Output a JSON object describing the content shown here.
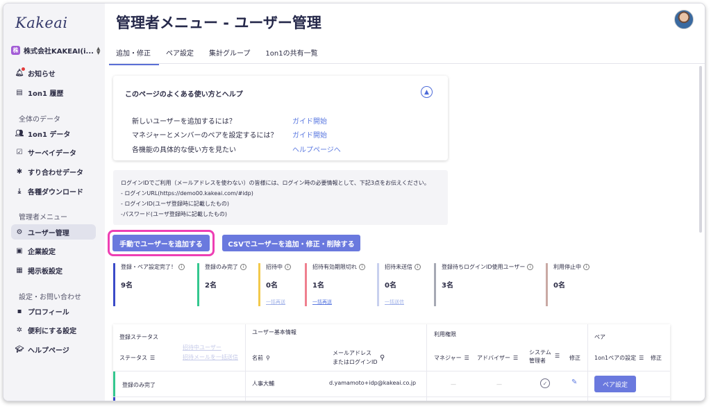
{
  "app": {
    "logo": "Kakeai"
  },
  "sidebar": {
    "company": {
      "badge": "株",
      "name": "株式会社KAKEAI(i..."
    },
    "items": [
      {
        "label": "お知らせ",
        "icon": "bell-icon"
      },
      {
        "label": "1on1 履歴",
        "icon": "history-icon"
      },
      {
        "label": "1on1 データ",
        "icon": "people-icon"
      },
      {
        "label": "サーベイデータ",
        "icon": "survey-icon"
      },
      {
        "label": "すり合わせデータ",
        "icon": "puzzle-icon"
      },
      {
        "label": "各種ダウンロード",
        "icon": "download-icon"
      },
      {
        "label": "ユーザー管理",
        "icon": "users-gear-icon"
      },
      {
        "label": "企業設定",
        "icon": "building-icon"
      },
      {
        "label": "掲示板設定",
        "icon": "board-icon"
      },
      {
        "label": "プロフィール",
        "icon": "profile-icon"
      },
      {
        "label": "便利にする設定",
        "icon": "gear-icon"
      },
      {
        "label": "ヘルプページ",
        "icon": "graduation-cap-icon"
      }
    ],
    "sections": {
      "data": "全体のデータ",
      "admin": "管理者メニュー",
      "settings": "設定・お問い合わせ"
    }
  },
  "header": {
    "title": "管理者メニュー - ユーザー管理"
  },
  "tabs": [
    {
      "label": "追加・修正"
    },
    {
      "label": "ペア設定"
    },
    {
      "label": "集計グループ"
    },
    {
      "label": "1on1の共有一覧"
    }
  ],
  "help": {
    "title": "このページのよくある使い方とヘルプ",
    "rows": [
      {
        "question": "新しいユーザーを追加するには？",
        "link": "ガイド開始"
      },
      {
        "question": "マネジャーとメンバーのペアを設定するには？",
        "link": "ガイド開始"
      },
      {
        "question": "各機能の具体的な使い方を見たい",
        "link": "ヘルプページへ"
      }
    ]
  },
  "info": {
    "lines": [
      "ログインIDでご利用（メールアドレスを使わない）の皆様には、ログイン時の必要情報として、下記3点をお伝えください。",
      "- ログインURL(https://demo00.kakeai.com/#idp)",
      "- ログインID(ユーザ登録時に記載したもの)",
      "-パスワード(ユーザ登録時に記載したもの)"
    ]
  },
  "buttons": {
    "manual_add": "手動でユーザーを追加する",
    "csv": "CSVでユーザーを追加・修正・削除する"
  },
  "stats": [
    {
      "label": "登録・ペア設定完了！",
      "value": "9名",
      "sub": "",
      "color": "#3b4bc8"
    },
    {
      "label": "登録のみ完了",
      "value": "2名",
      "sub": "",
      "color": "#34c78f"
    },
    {
      "label": "招待中",
      "value": "0名",
      "sub": "一括再送",
      "color": "#f2c94c"
    },
    {
      "label": "招待有効期限切れ",
      "value": "1名",
      "sub": "一括再送",
      "color": "#ef7f8e"
    },
    {
      "label": "招待未送信",
      "value": "0名",
      "sub": "一括送信",
      "color": "#c8d0ee"
    },
    {
      "label": "登録待ちログインID使用ユーザー",
      "value": "3名",
      "sub": "",
      "color": "#a6a9b4"
    },
    {
      "label": "利用停止中",
      "value": "0名",
      "sub": "",
      "color": "#c9a9a4"
    }
  ],
  "table": {
    "groups": {
      "status": "登録ステータス",
      "basic": "ユーザー基本情報",
      "perm": "利用権限",
      "pair": "ペア"
    },
    "columns": {
      "status": "ステータス",
      "invite_user": "招待中ユーザー",
      "invite_mail": "招待メールを一括送信",
      "name": "名前",
      "email_1": "メールアドレス",
      "email_2": "またはログインID",
      "manager": "マネジャー",
      "advisor": "アドバイザー",
      "system_1": "システム",
      "system_2": "管理者",
      "edit": "修正",
      "pair_setting": "1on1ペアの設定",
      "pair_edit": "修正"
    },
    "rows": [
      {
        "status": "登録のみ完了",
        "name": "人事大輔",
        "email": "d.yamamoto+idp@kakeai.co.jp",
        "manager": "—",
        "advisor": "—",
        "pair_button": "ペア設定"
      }
    ]
  }
}
